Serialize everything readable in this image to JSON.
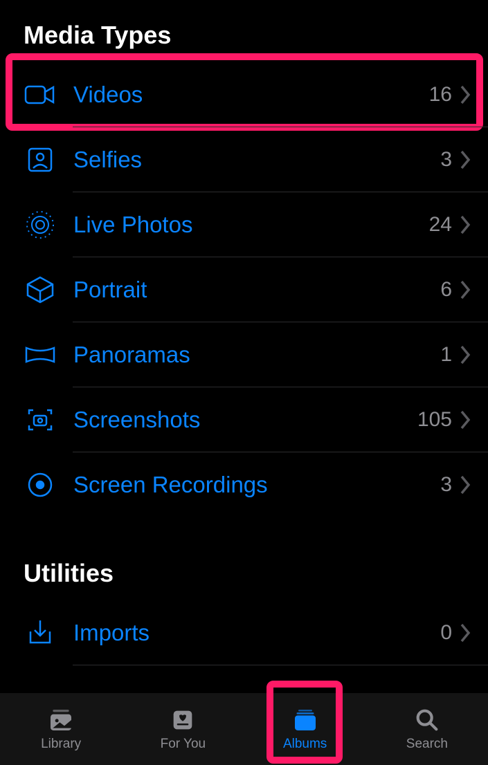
{
  "media_types": {
    "title": "Media Types",
    "items": [
      {
        "label": "Videos",
        "count": "16"
      },
      {
        "label": "Selfies",
        "count": "3"
      },
      {
        "label": "Live Photos",
        "count": "24"
      },
      {
        "label": "Portrait",
        "count": "6"
      },
      {
        "label": "Panoramas",
        "count": "1"
      },
      {
        "label": "Screenshots",
        "count": "105"
      },
      {
        "label": "Screen Recordings",
        "count": "3"
      }
    ]
  },
  "utilities": {
    "title": "Utilities",
    "items": [
      {
        "label": "Imports",
        "count": "0"
      }
    ]
  },
  "tabs": {
    "library": "Library",
    "for_you": "For You",
    "albums": "Albums",
    "search": "Search"
  }
}
